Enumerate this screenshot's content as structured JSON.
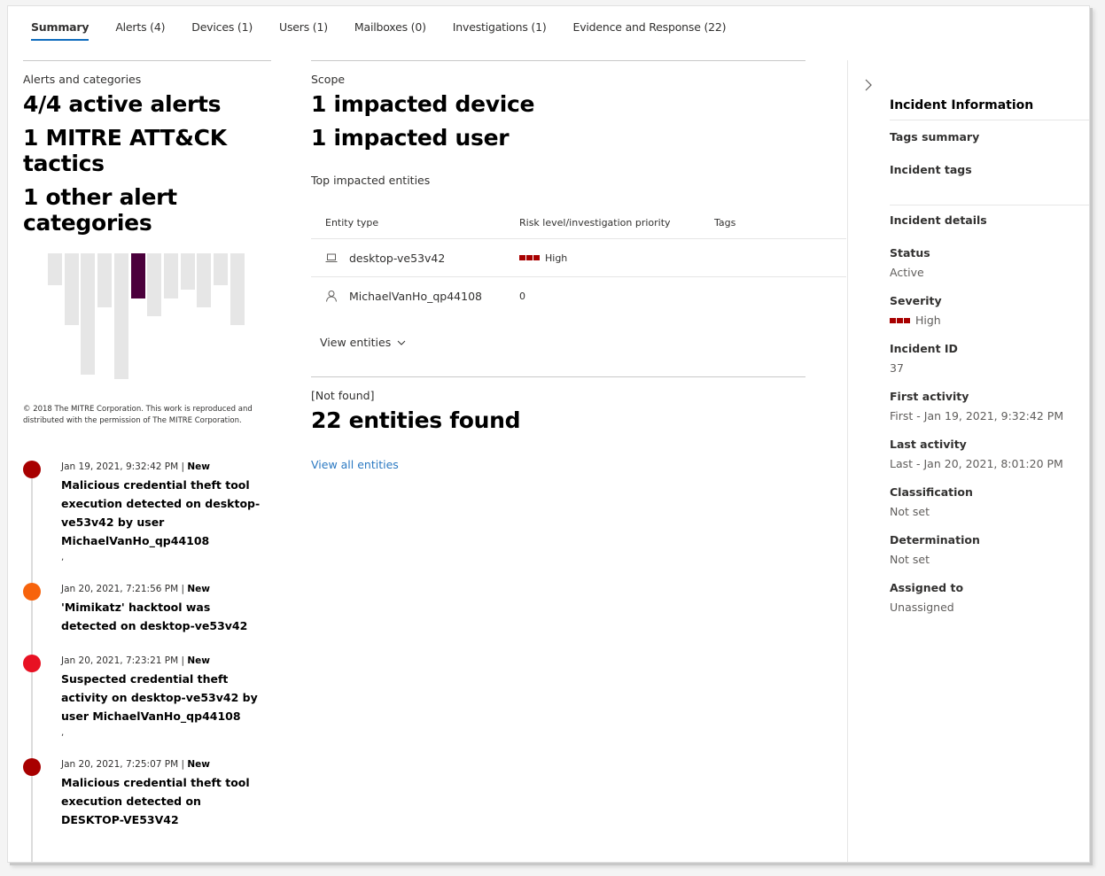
{
  "tabs": [
    {
      "label": "Summary",
      "active": true
    },
    {
      "label": "Alerts (4)",
      "active": false
    },
    {
      "label": "Devices (1)",
      "active": false
    },
    {
      "label": "Users (1)",
      "active": false
    },
    {
      "label": "Mailboxes (0)",
      "active": false
    },
    {
      "label": "Investigations (1)",
      "active": false
    },
    {
      "label": "Evidence and Response (22)",
      "active": false
    }
  ],
  "alerts_section": {
    "label": "Alerts and categories",
    "active_alerts": "4/4 active alerts",
    "mitre_tactics": "1 MITRE ATT&CK tactics",
    "other_categories": "1 other alert categories",
    "mitre_matrix": {
      "tactic_technique_counts": [
        7,
        16,
        27,
        12,
        28,
        10,
        14,
        10,
        8,
        12,
        7,
        16
      ],
      "active_index": 5,
      "active_color": "#4b003c",
      "inactive_color": "#e6e6e6"
    },
    "copyright": "© 2018 The MITRE Corporation. This work is reproduced and distributed with the permission of The MITRE Corporation."
  },
  "timeline": [
    {
      "time": "Jan 19, 2021, 9:32:42 PM",
      "status": "New",
      "title": "Malicious credential theft tool execution detected on desktop-ve53v42 by user MichaelVanHo_qp44108",
      "trailing": ",",
      "color": "#a80000"
    },
    {
      "time": "Jan 20, 2021, 7:21:56 PM",
      "status": "New",
      "title": "'Mimikatz' hacktool was detected on desktop-ve53v42",
      "trailing": "",
      "color": "#f7630c"
    },
    {
      "time": "Jan 20, 2021, 7:23:21 PM",
      "status": "New",
      "title": "Suspected credential theft activity on desktop-ve53v42 by user MichaelVanHo_qp44108",
      "trailing": ",",
      "color": "#e81123"
    },
    {
      "time": "Jan 20, 2021, 7:25:07 PM",
      "status": "New",
      "title": "Malicious credential theft tool execution detected on DESKTOP-VE53V42",
      "trailing": "",
      "color": "#a80000"
    }
  ],
  "scope": {
    "label": "Scope",
    "impacted_devices": "1 impacted device",
    "impacted_users": "1 impacted user",
    "top_entities_label": "Top impacted entities",
    "columns": [
      "Entity type",
      "Risk level/investigation priority",
      "Tags"
    ],
    "rows": [
      {
        "icon": "laptop-icon",
        "name": "desktop-ve53v42",
        "risk": "High",
        "risk_bars": true,
        "tags": ""
      },
      {
        "icon": "person-icon",
        "name": "MichaelVanHo_qp44108",
        "risk": "0",
        "risk_bars": false,
        "tags": ""
      }
    ],
    "view_entities": "View entities"
  },
  "evidence": {
    "status": "[Not found]",
    "count_text": "22 entities found",
    "view_all": "View all entities"
  },
  "incident_panel": {
    "title": "Incident Information",
    "tags_summary": "Tags summary",
    "incident_tags": "Incident tags",
    "details_title": "Incident details",
    "fields": {
      "status": {
        "label": "Status",
        "value": "Active"
      },
      "severity": {
        "label": "Severity",
        "value": "High"
      },
      "incident_id": {
        "label": "Incident ID",
        "value": "37"
      },
      "first_activity": {
        "label": "First activity",
        "value": "First - Jan 19, 2021, 9:32:42 PM"
      },
      "last_activity": {
        "label": "Last activity",
        "value": "Last - Jan 20, 2021, 8:01:20 PM"
      },
      "classification": {
        "label": "Classification",
        "value": "Not set"
      },
      "determination": {
        "label": "Determination",
        "value": "Not set"
      },
      "assigned_to": {
        "label": "Assigned to",
        "value": "Unassigned"
      }
    }
  },
  "colors": {
    "accent": "#0f6cbd",
    "link": "#2b79c2",
    "severity_high": "#a80000"
  }
}
